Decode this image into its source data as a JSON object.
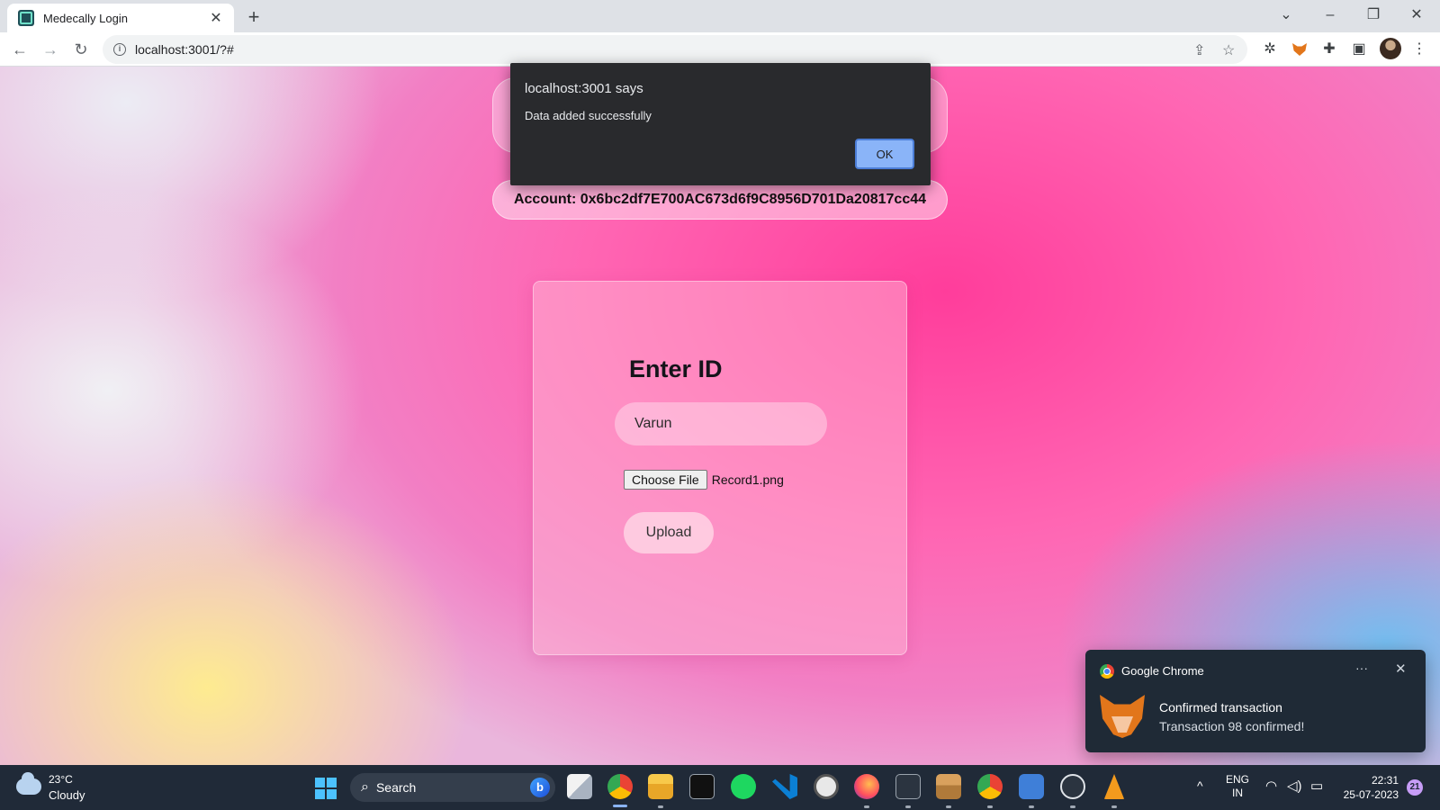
{
  "browser": {
    "tab_title": "Medecally Login",
    "tab_close": "✕",
    "new_tab": "+",
    "address": "localhost:3001/?#",
    "window_controls": {
      "tabs_search": "⌄",
      "minimize": "–",
      "restore": "❐",
      "close": "✕"
    },
    "nav": {
      "back": "←",
      "forward": "→",
      "reload": "↻"
    },
    "toolbar_icons": [
      "share-icon",
      "bookmark-star-icon",
      "bug-extension-icon",
      "metamask-icon",
      "puzzle-extensions-icon",
      "side-panel-icon",
      "profile-avatar",
      "kebab-menu-icon"
    ]
  },
  "page": {
    "account_label": "Account: 0x6bc2df7E700AC673d6f9C8956D701Da20817cc44",
    "card": {
      "title": "Enter ID",
      "id_value": "Varun",
      "choose_file_label": "Choose File",
      "file_name": "Record1.png",
      "upload_label": "Upload"
    }
  },
  "dialog": {
    "title": "localhost:3001 says",
    "message": "Data added successfully",
    "ok_label": "OK"
  },
  "notification": {
    "app": "Google Chrome",
    "more": "···",
    "close": "✕",
    "heading": "Confirmed transaction",
    "body": "Transaction 98 confirmed!"
  },
  "taskbar": {
    "weather_temp": "23°C",
    "weather_condition": "Cloudy",
    "search_placeholder": "Search",
    "bing_letter": "b",
    "lang_top": "ENG",
    "lang_bottom": "IN",
    "time": "22:31",
    "date": "25-07-2023",
    "notification_count": "21",
    "apps": [
      "task-view",
      "chrome",
      "file-explorer",
      "terminal",
      "spotify",
      "vscode",
      "clock",
      "firefox",
      "powershell",
      "package",
      "chrome-profile",
      "camera",
      "media-player",
      "vlc"
    ]
  },
  "colors": {
    "accent_pink": "#ff3d9b",
    "dialog_bg": "#292a2d",
    "ok_button": "#8ab4f8",
    "taskbar_bg": "#202a38"
  }
}
